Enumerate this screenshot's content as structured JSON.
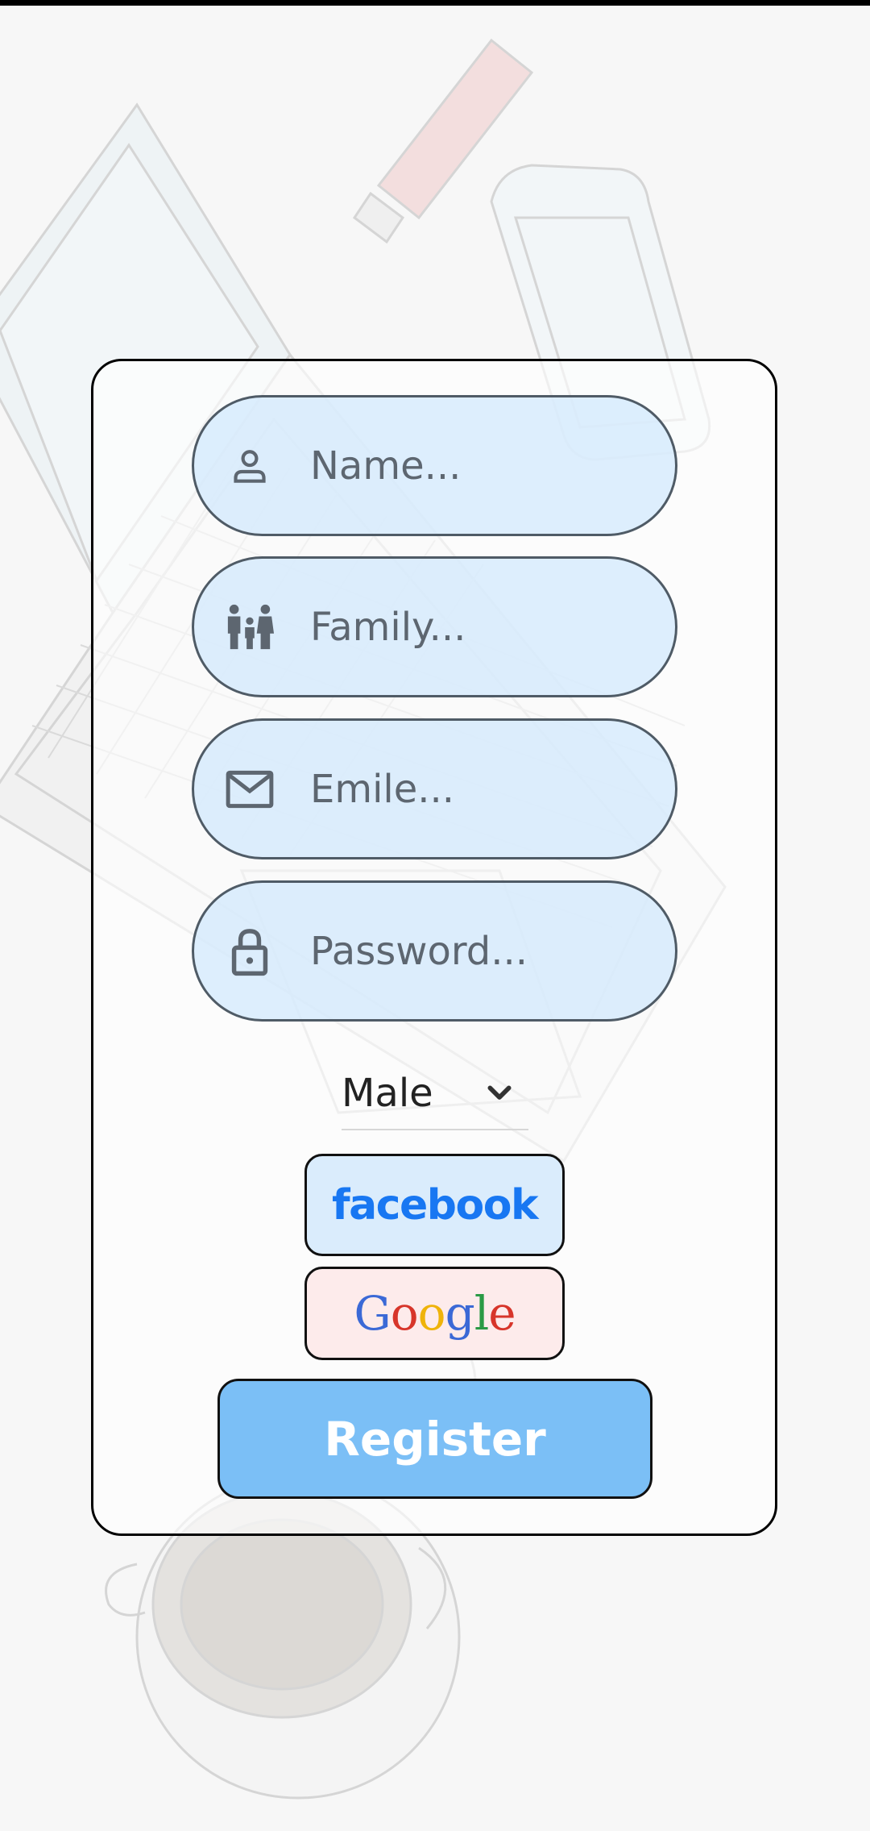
{
  "form": {
    "name_placeholder": "Name...",
    "family_placeholder": "Family...",
    "email_placeholder": "Emile...",
    "password_placeholder": "Password...",
    "gender_selected": "Male"
  },
  "social": {
    "facebook_label": "facebook",
    "google_label": "Google"
  },
  "actions": {
    "register_label": "Register"
  },
  "icons": {
    "name": "person-icon",
    "family": "family-icon",
    "email": "envelope-icon",
    "password": "lock-icon",
    "dropdown": "chevron-down-icon"
  },
  "colors": {
    "field_bg": "#d6eafc",
    "register_bg": "#7bbff6",
    "facebook_blue": "#1877f2",
    "google_bg": "#fdeaea"
  }
}
